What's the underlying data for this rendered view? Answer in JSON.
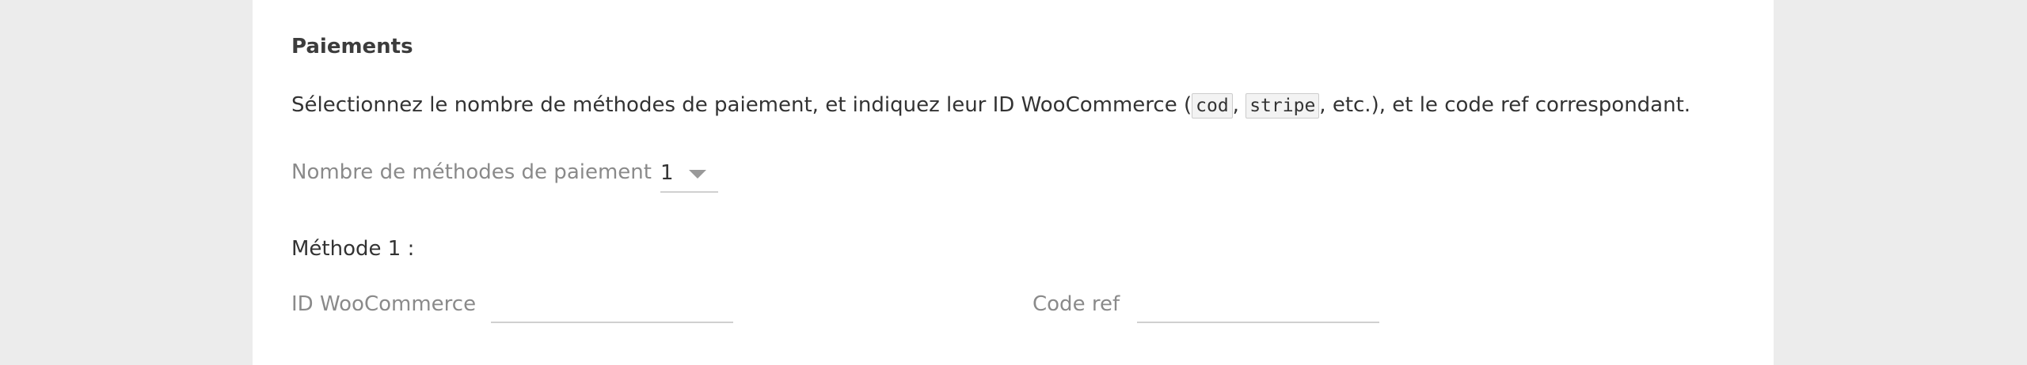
{
  "section": {
    "title": "Paiements"
  },
  "description": {
    "before": "Sélectionnez le nombre de méthodes de paiement, et indiquez leur ID WooCommerce (",
    "code1": "cod",
    "between": ", ",
    "code2": "stripe",
    "after": ", etc.), et le code ref correspondant."
  },
  "payment_count": {
    "label": "Nombre de méthodes de paiement",
    "value": "1"
  },
  "method_1": {
    "title": "Méthode 1 :",
    "woocommerce_id_label": "ID WooCommerce",
    "woocommerce_id_value": "",
    "code_ref_label": "Code ref",
    "code_ref_value": ""
  },
  "colors": {
    "background": "#ececec",
    "panel": "#ffffff",
    "label": "#8a8a8a",
    "text": "#333333",
    "underline": "#d0d0d0"
  }
}
